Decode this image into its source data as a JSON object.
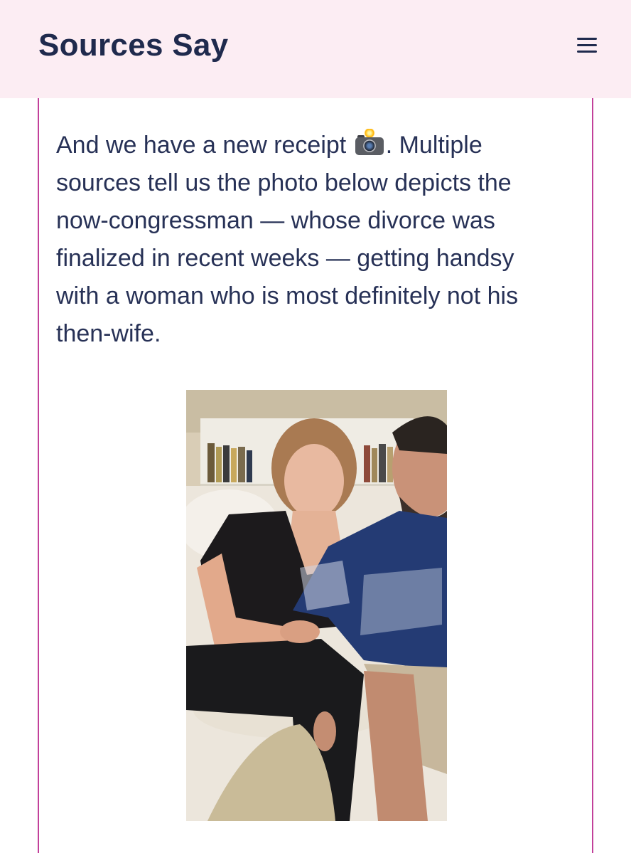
{
  "header": {
    "site_title": "Sources Say",
    "menu_icon": "hamburger-menu-icon",
    "background_color": "#fcedf3",
    "title_color": "#1f2a4d"
  },
  "article": {
    "paragraph_before_emoji": "And we have a new receipt ",
    "emoji_icon": "camera-with-flash-icon",
    "paragraph_after_emoji": ". Multiple sources tell us the photo below depicts the now-congressman — whose divorce was finalized in recent weeks — getting handsy with a woman who is most definitely not his then-wife.",
    "border_color": "#c2409a",
    "text_color": "#273156"
  },
  "photo": {
    "description_icon": "photo-image"
  }
}
